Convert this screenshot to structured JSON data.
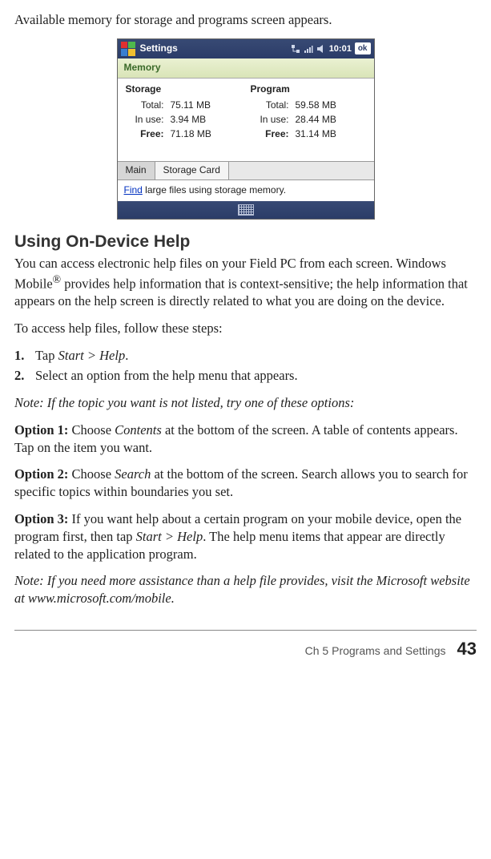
{
  "intro": "Available memory for storage and programs screen appears.",
  "device": {
    "titlebar_title": "Settings",
    "clock": "10:01",
    "ok": "ok",
    "subheader": "Memory",
    "storage": {
      "title": "Storage",
      "total_label": "Total:",
      "total_value": "75.11 MB",
      "inuse_label": "In use:",
      "inuse_value": "3.94 MB",
      "free_label": "Free:",
      "free_value": "71.18 MB"
    },
    "program": {
      "title": "Program",
      "total_label": "Total:",
      "total_value": "59.58 MB",
      "inuse_label": "In use:",
      "inuse_value": "28.44 MB",
      "free_label": "Free:",
      "free_value": "31.14 MB"
    },
    "tab_main": "Main",
    "tab_storage_card": "Storage Card",
    "find_link": "Find",
    "find_rest": " large files using storage memory."
  },
  "heading": "Using On-Device Help",
  "para1a": "You can access electronic help files on your Field PC from each screen. Windows Mobile",
  "para1b": " provides help information that is context-sensitive; the help information that appears on the help screen is directly related to what you are doing on the device.",
  "para2": "To access help files, follow these steps:",
  "step1_pre": " Tap ",
  "step1_ital": "Start > Help",
  "step1_post": ".",
  "step2": "Select an option from the help menu that appears.",
  "note1": "Note: If the topic you want is not listed, try one of these options:",
  "opt1_label": "Option 1:",
  "opt1_a": " Choose ",
  "opt1_ital": "Contents",
  "opt1_b": " at the bottom of the screen. A table of contents appears. Tap on the item you want.",
  "opt2_label": "Option 2:",
  "opt2_a": " Choose ",
  "opt2_ital": "Search",
  "opt2_b": " at the bottom of the screen. Search allows you to search for specific topics within boundaries you set.",
  "opt3_label": "Option 3:",
  "opt3_a": " If you want help about a certain program on your mobile device, open the program first, then tap ",
  "opt3_ital": "Start > Help",
  "opt3_b": ". The help menu items that appear are directly related to the application program.",
  "note2_a": "Note: If you need more assistance than a help file provides, visit the Microsoft website at ",
  "note2_b": "www.microsoft.com/mobile",
  "note2_c": ".",
  "footer_chapter": "Ch 5    Programs and Settings",
  "footer_page": "43"
}
